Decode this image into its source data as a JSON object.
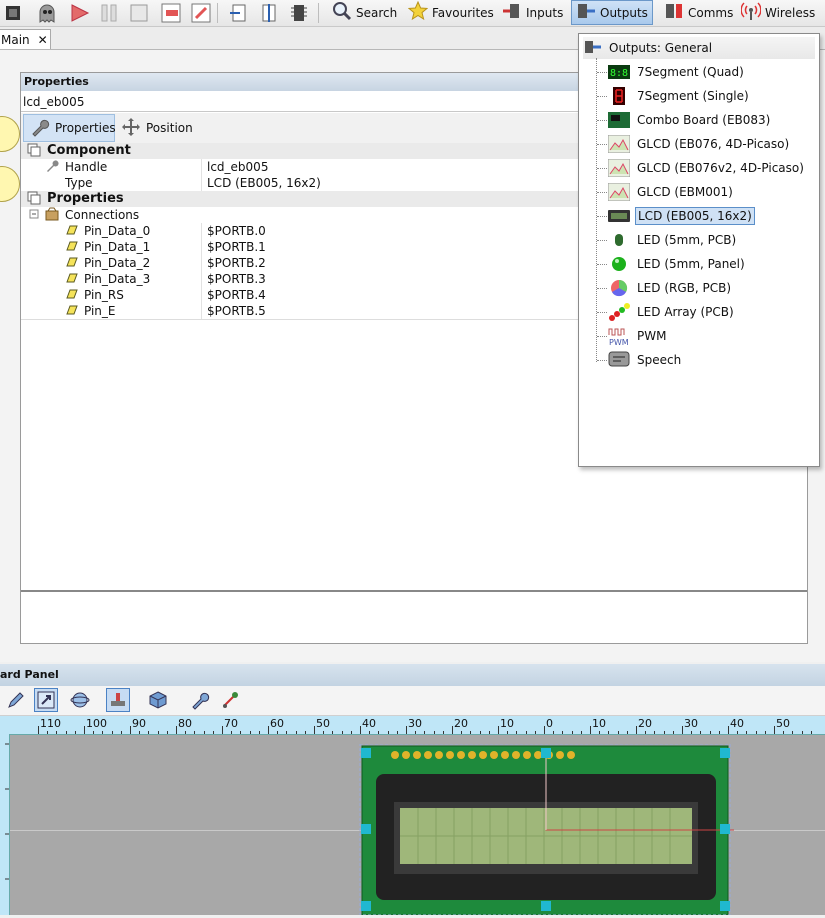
{
  "toolbar": {
    "search": "Search",
    "favourites": "Favourites",
    "inputs": "Inputs",
    "outputs": "Outputs",
    "comms": "Comms",
    "wireless": "Wireless"
  },
  "doc_tab": {
    "label": "Main",
    "close": "✕"
  },
  "properties": {
    "title": "Properties",
    "handle_value": "lcd_eb005",
    "tabs": {
      "properties": "Properties",
      "position": "Position"
    },
    "component": {
      "heading": "Component",
      "handle_label": "Handle",
      "handle_value": "lcd_eb005",
      "type_label": "Type",
      "type_value": "LCD (EB005, 16x2)"
    },
    "props_heading": "Properties",
    "connections_label": "Connections",
    "pins": [
      {
        "name": "Pin_Data_0",
        "value": "$PORTB.0"
      },
      {
        "name": "Pin_Data_1",
        "value": "$PORTB.1"
      },
      {
        "name": "Pin_Data_2",
        "value": "$PORTB.2"
      },
      {
        "name": "Pin_Data_3",
        "value": "$PORTB.3"
      },
      {
        "name": "Pin_RS",
        "value": "$PORTB.4"
      },
      {
        "name": "Pin_E",
        "value": "$PORTB.5"
      }
    ]
  },
  "outputs_menu": {
    "header": "Outputs: General",
    "items": [
      {
        "label": "7Segment (Quad)",
        "icon": "seven-segment-quad-icon"
      },
      {
        "label": "7Segment (Single)",
        "icon": "seven-segment-single-icon"
      },
      {
        "label": "Combo Board (EB083)",
        "icon": "combo-board-icon"
      },
      {
        "label": "GLCD (EB076, 4D-Picaso)",
        "icon": "glcd-icon"
      },
      {
        "label": "GLCD (EB076v2, 4D-Picaso)",
        "icon": "glcd-icon"
      },
      {
        "label": "GLCD (EBM001)",
        "icon": "glcd-icon"
      },
      {
        "label": "LCD (EB005, 16x2)",
        "icon": "lcd-icon",
        "selected": true
      },
      {
        "label": "LED (5mm, PCB)",
        "icon": "led-pcb-icon"
      },
      {
        "label": "LED (5mm, Panel)",
        "icon": "led-panel-icon"
      },
      {
        "label": "LED (RGB, PCB)",
        "icon": "led-rgb-icon"
      },
      {
        "label": "LED Array (PCB)",
        "icon": "led-array-icon"
      },
      {
        "label": "PWM",
        "icon": "pwm-icon"
      },
      {
        "label": "Speech",
        "icon": "speech-icon"
      }
    ]
  },
  "dashboard": {
    "title": "ard Panel",
    "ruler_labels": [
      "110",
      "100",
      "90",
      "80",
      "70",
      "60",
      "50",
      "40",
      "30",
      "20",
      "10",
      "0",
      "10",
      "20",
      "30",
      "40",
      "50"
    ]
  },
  "colors": {
    "selection_fill": "#cfe1f5",
    "selection_border": "#5b8fc9",
    "pcb_green": "#1e8a3c",
    "lcd_screen": "#9fb77a"
  }
}
